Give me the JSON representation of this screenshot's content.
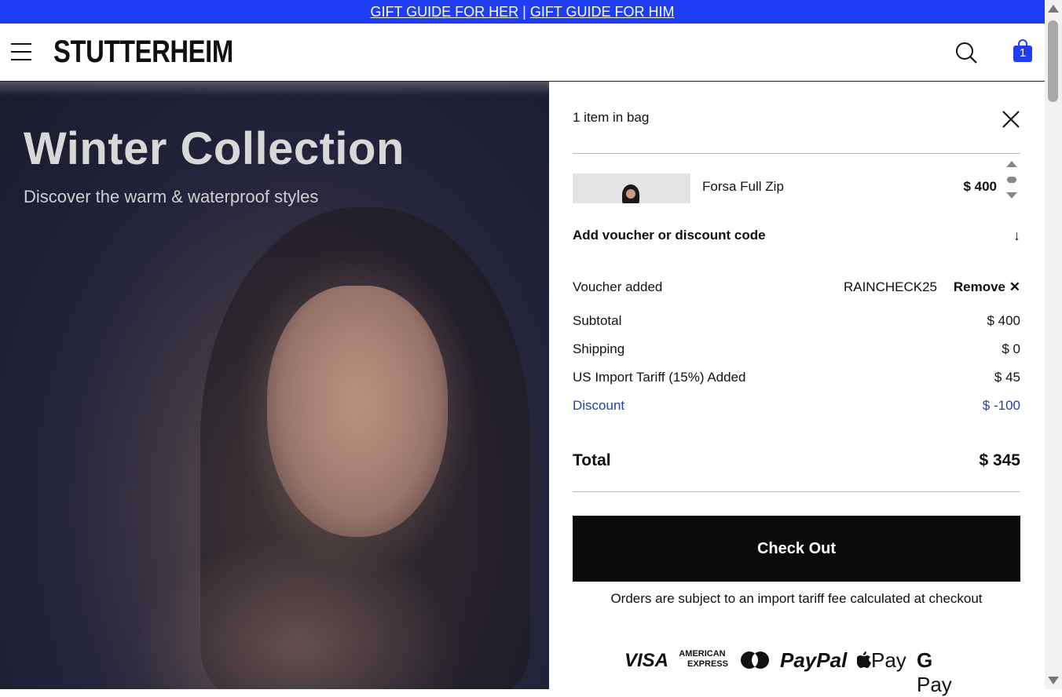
{
  "announcement": {
    "link_her": "GIFT GUIDE FOR HER",
    "separator": "|",
    "link_him": "GIFT GUIDE FOR HIM"
  },
  "header": {
    "logo": "STUTTERHEIM",
    "bag_count": "1",
    "icons": [
      "menu-icon",
      "search-icon",
      "shopping-bag-icon"
    ]
  },
  "hero": {
    "title": "Winter Collection",
    "subtitle": "Discover the warm & waterproof styles"
  },
  "cart": {
    "title": "1 item in bag",
    "items": [
      {
        "name": "Forsa Full Zip",
        "price": "$ 400"
      }
    ],
    "voucher_toggle": "Add voucher or discount code",
    "voucher_label": "Voucher added",
    "voucher_code": "RAINCHECK25",
    "remove_label": "Remove",
    "subtotal_label": "Subtotal",
    "subtotal_value": "$ 400",
    "shipping_label": "Shipping",
    "shipping_value": "$ 0",
    "tariff_label": "US Import Tariff (15%) Added",
    "tariff_value": "$ 45",
    "discount_label": "Discount",
    "discount_value": "$ -100",
    "total_label": "Total",
    "total_value": "$ 345",
    "checkout_label": "Check Out",
    "tariff_note": "Orders are subject to an import tariff fee calculated at checkout"
  },
  "payments": {
    "visa": "VISA",
    "amex_line1": "AMERICAN",
    "amex_line2": "EXPRESS",
    "paypal": "PayPal",
    "apple_pay": "Pay",
    "google_pay": "Pay"
  },
  "colors": {
    "accent": "#1f3df2",
    "discount": "#1f3eb8",
    "checkout": "#0b0b0b"
  }
}
